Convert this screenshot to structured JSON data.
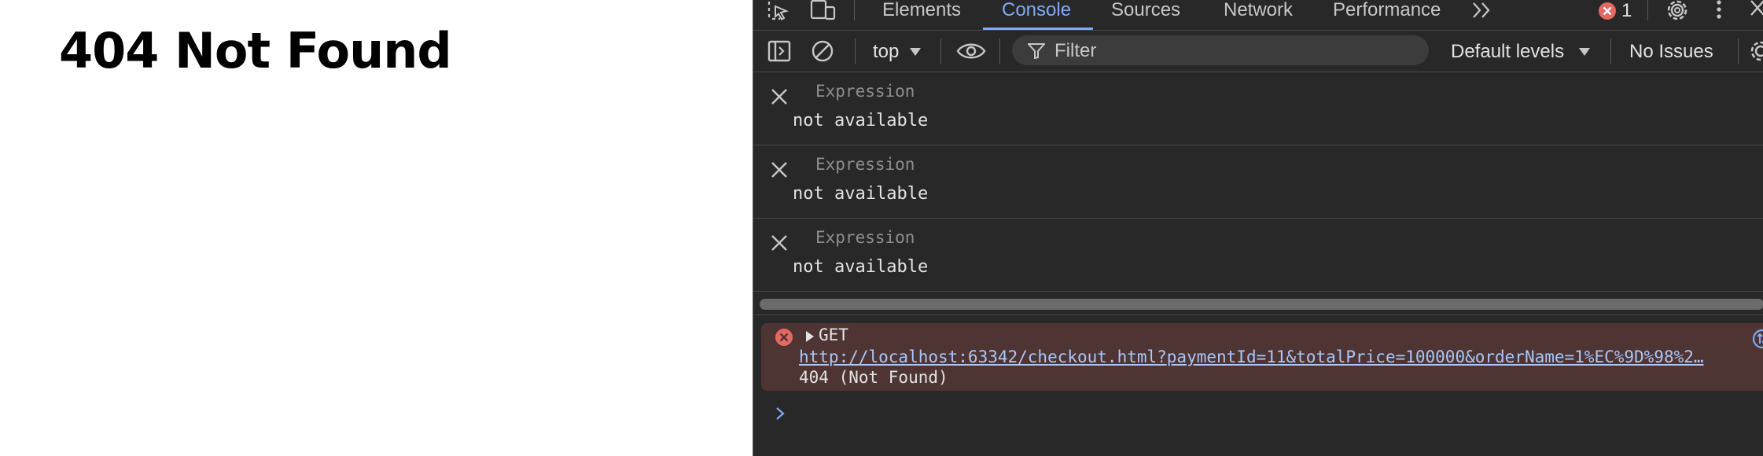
{
  "page": {
    "heading": "404 Not Found"
  },
  "devtools": {
    "tabs": [
      {
        "label": "Elements"
      },
      {
        "label": "Console"
      },
      {
        "label": "Sources"
      },
      {
        "label": "Network"
      },
      {
        "label": "Performance"
      }
    ],
    "error_count": "1",
    "toolbar": {
      "context": "top",
      "filter_placeholder": "Filter",
      "levels": "Default levels",
      "issues": "No Issues"
    },
    "watch_expressions": [
      {
        "placeholder": "Expression",
        "value": "not available"
      },
      {
        "placeholder": "Expression",
        "value": "not available"
      },
      {
        "placeholder": "Expression",
        "value": "not available"
      }
    ],
    "console_error": {
      "method": "GET",
      "url": "http://localhost:63342/checkout.html?paymentId=11&totalPrice=100000&orderName=1%EC%9D%98%2…",
      "status": "404 (Not Found)"
    },
    "colors": {
      "background": "#282828",
      "accent": "#7cacf8",
      "error_bg": "#4e3534",
      "error_icon": "#e46962",
      "link": "#a8c7fa"
    },
    "icons": [
      "inspect-element-icon",
      "device-toggle-icon",
      "more-tabs-icon",
      "error-icon",
      "settings-icon",
      "kebab-menu-icon",
      "close-icon",
      "sidebar-toggle-icon",
      "clear-console-icon",
      "dropdown-arrow-icon",
      "eye-icon",
      "filter-icon",
      "settings-icon",
      "remove-expression-icon",
      "expand-arrow-icon",
      "network-request-icon",
      "console-prompt-icon"
    ]
  }
}
